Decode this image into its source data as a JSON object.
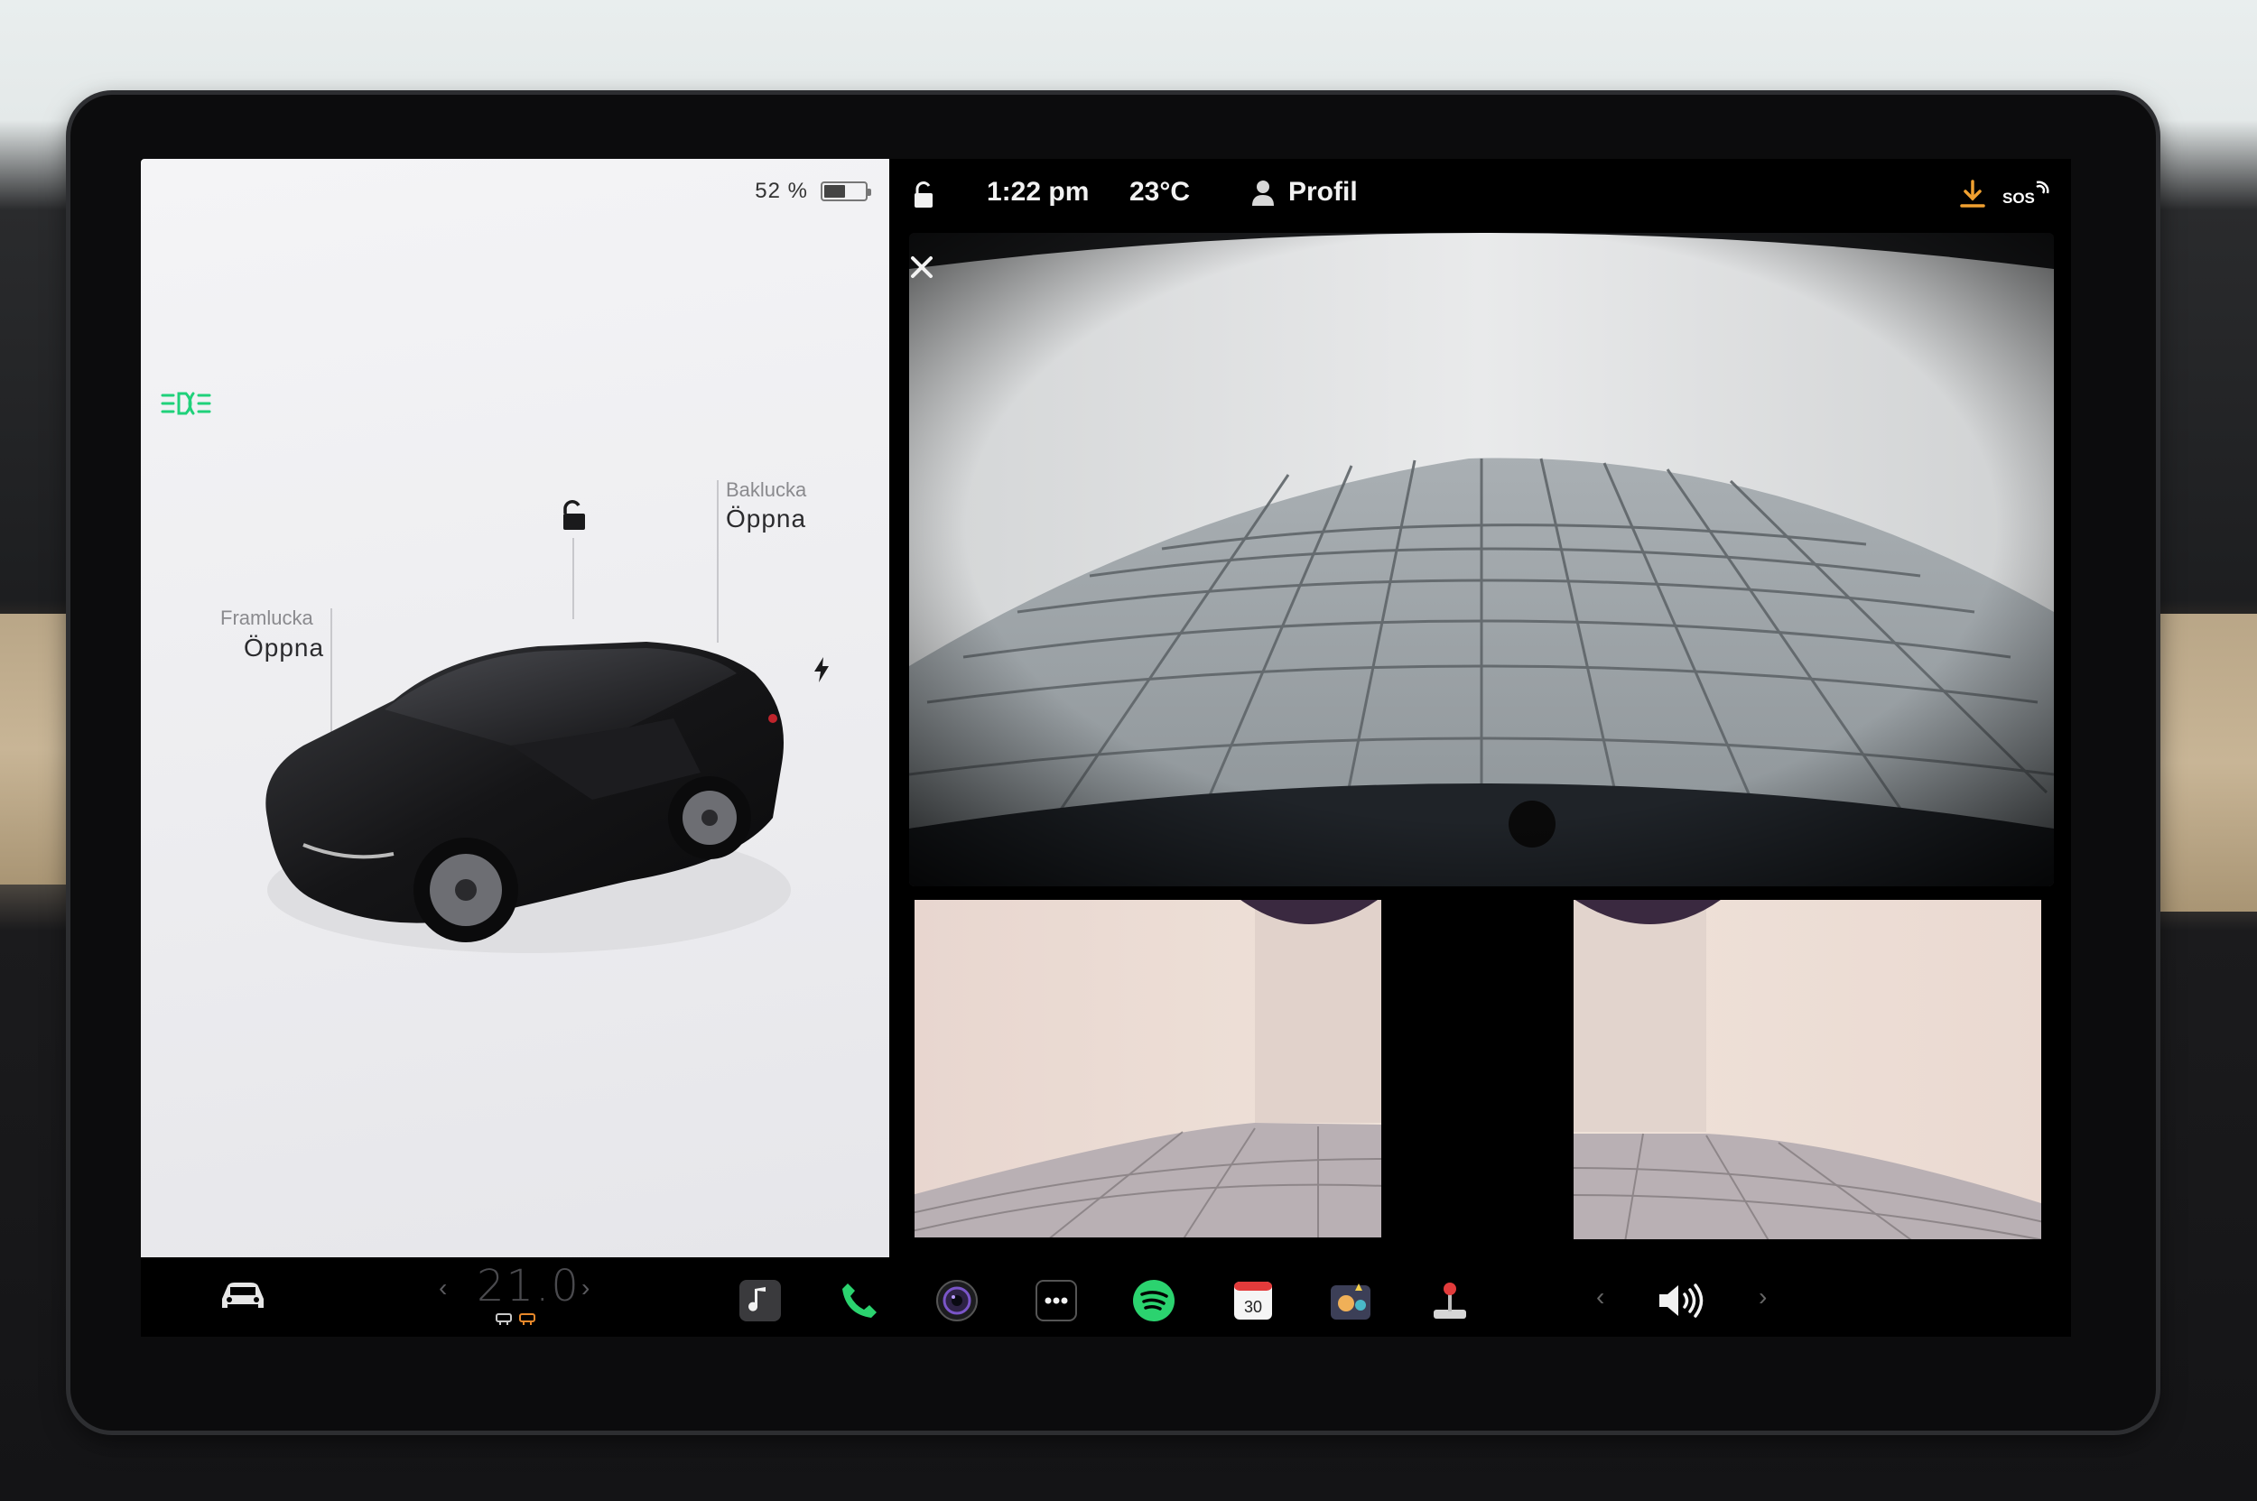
{
  "car_panel": {
    "battery_percent": "52 %",
    "battery_level": 0.52,
    "frunk": {
      "label": "Framlucka",
      "action": "Öppna"
    },
    "trunk": {
      "label": "Baklucka",
      "action": "Öppna"
    }
  },
  "status_bar": {
    "time": "1:22 pm",
    "temperature": "23°C",
    "profile": "Profil",
    "sos": "SOS"
  },
  "climate": {
    "temperature": "21.0"
  },
  "calendar_day": "30",
  "dock": {
    "apps": [
      "car-icon",
      "music-icon",
      "phone-icon",
      "camera-icon",
      "more-icon",
      "spotify-icon",
      "calendar-icon",
      "toybox-icon",
      "joystick-icon",
      "volume-icon"
    ]
  },
  "colors": {
    "accent_green": "#2bd36f",
    "download_orange": "#f0a030",
    "headlight_green": "#1fd17a"
  }
}
